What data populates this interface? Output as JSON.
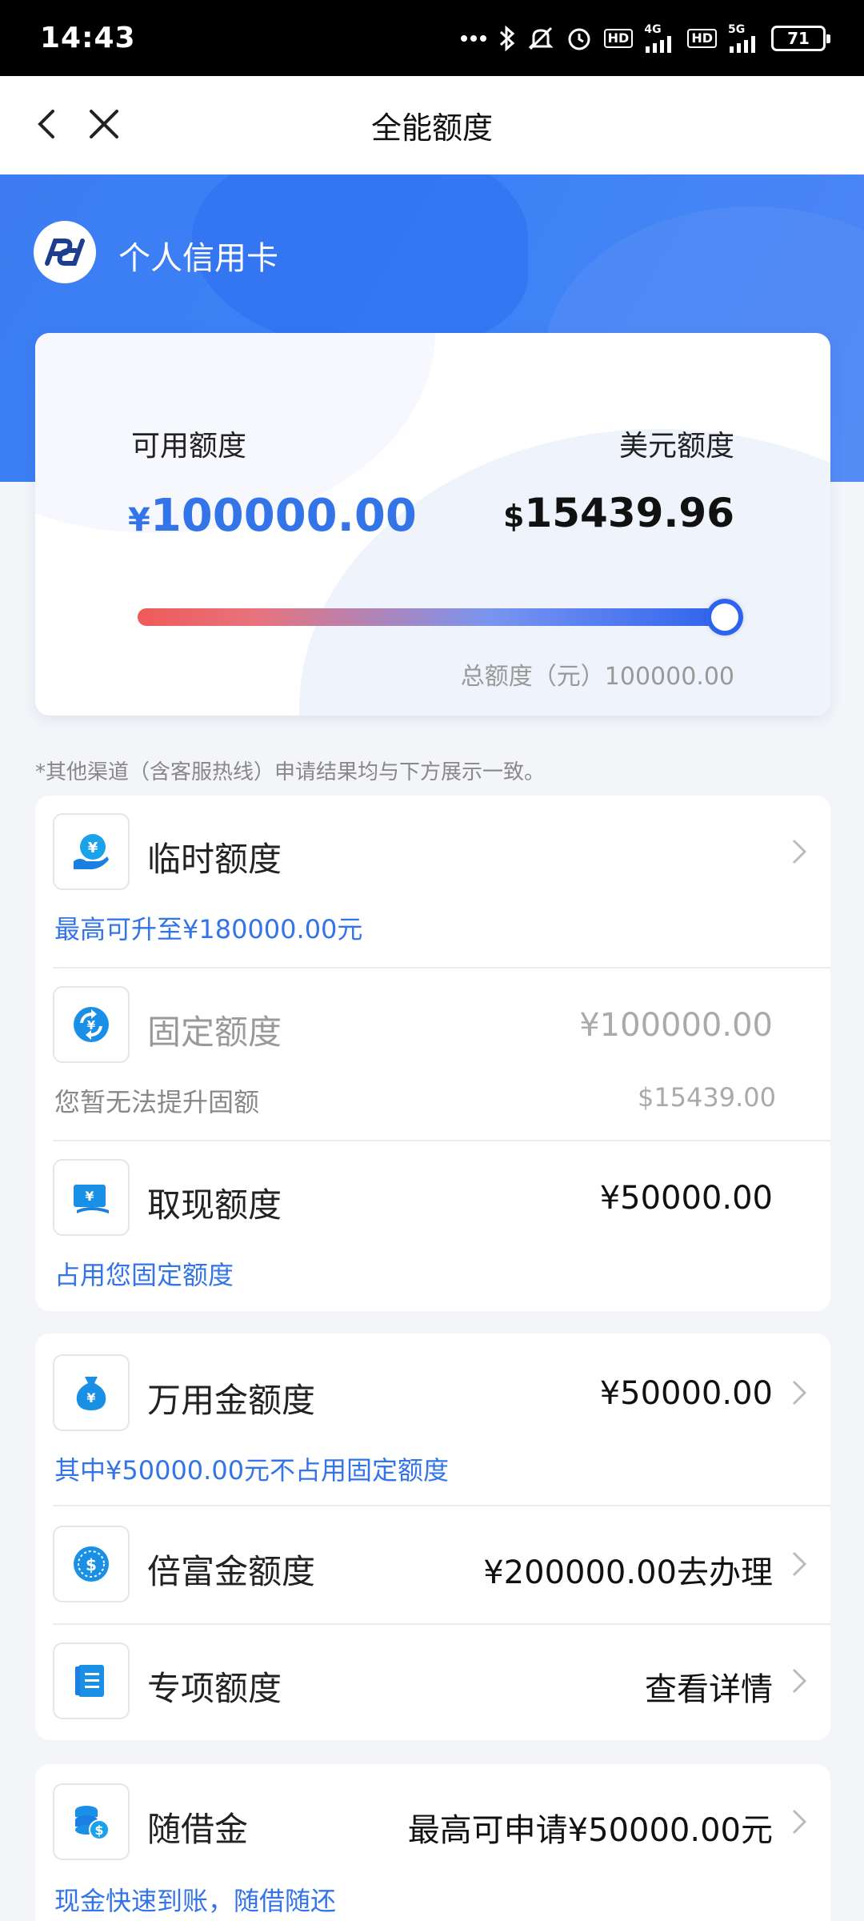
{
  "status_bar": {
    "time": "14:43",
    "battery": "71",
    "icons": [
      "more-dots-icon",
      "bluetooth-icon",
      "mute-icon",
      "alarm-icon",
      "hd-icon",
      "signal-4g-icon",
      "hd-icon",
      "signal-5g-icon",
      "battery-icon"
    ],
    "hd1": "HD",
    "net1": "4G",
    "hd2": "HD",
    "net2": "5G"
  },
  "nav": {
    "title": "全能额度"
  },
  "banner": {
    "bank_name": "个人信用卡"
  },
  "credit_card": {
    "available_label": "可用额度",
    "usd_label": "美元额度",
    "available_currency": "¥",
    "available_amount": "100000.00",
    "usd_currency": "$",
    "usd_amount": "15439.96",
    "usage_fraction": 1.0,
    "total_label": "总额度（元）100000.00"
  },
  "note": "*其他渠道（含客服热线）申请结果均与下方展示一致。",
  "card1": {
    "temp": {
      "title": "临时额度",
      "sub": "最高可升至¥180000.00元"
    },
    "fixed": {
      "title": "固定额度",
      "value": "¥100000.00",
      "sub": "您暂无法提升固额",
      "sub_value": "$15439.00"
    },
    "cash": {
      "title": "取现额度",
      "value": "¥50000.00",
      "sub": "占用您固定额度"
    }
  },
  "card2": {
    "wanyong": {
      "title": "万用金额度",
      "value": "¥50000.00",
      "sub": "其中¥50000.00元不占用固定额度"
    },
    "beifu": {
      "title": "倍富金额度",
      "value": "¥200000.00去办理"
    },
    "special": {
      "title": "专项额度",
      "value": "查看详情"
    }
  },
  "card3": {
    "suijie": {
      "title": "随借金",
      "value": "最高可申请¥50000.00元",
      "sub": "现金快速到账，随借随还"
    }
  },
  "colors": {
    "accent": "#3374e8",
    "banner": "#3b82f6"
  }
}
